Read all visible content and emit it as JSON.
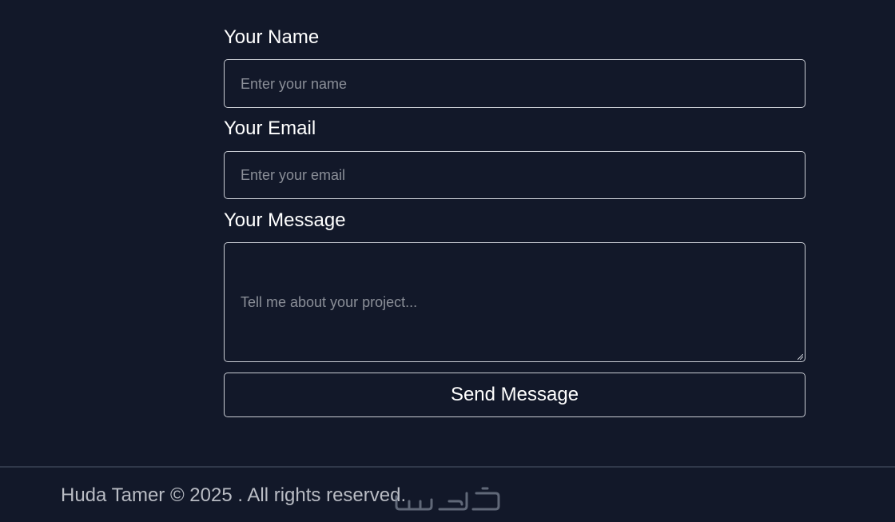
{
  "form": {
    "name": {
      "label": "Your Name",
      "placeholder": "Enter your name"
    },
    "email": {
      "label": "Your Email",
      "placeholder": "Enter your email"
    },
    "message": {
      "label": "Your Message",
      "placeholder": "Tell me about your project..."
    },
    "submit_label": "Send Message"
  },
  "footer": {
    "copyright": "Huda Tamer © 2025 . All rights reserved.",
    "watermark": "خمسات"
  },
  "colors": {
    "background": "#121829",
    "border": "#c9ccd3",
    "placeholder": "#8b8f98",
    "footer_text": "#b9bcc4",
    "divider": "#30384a"
  }
}
